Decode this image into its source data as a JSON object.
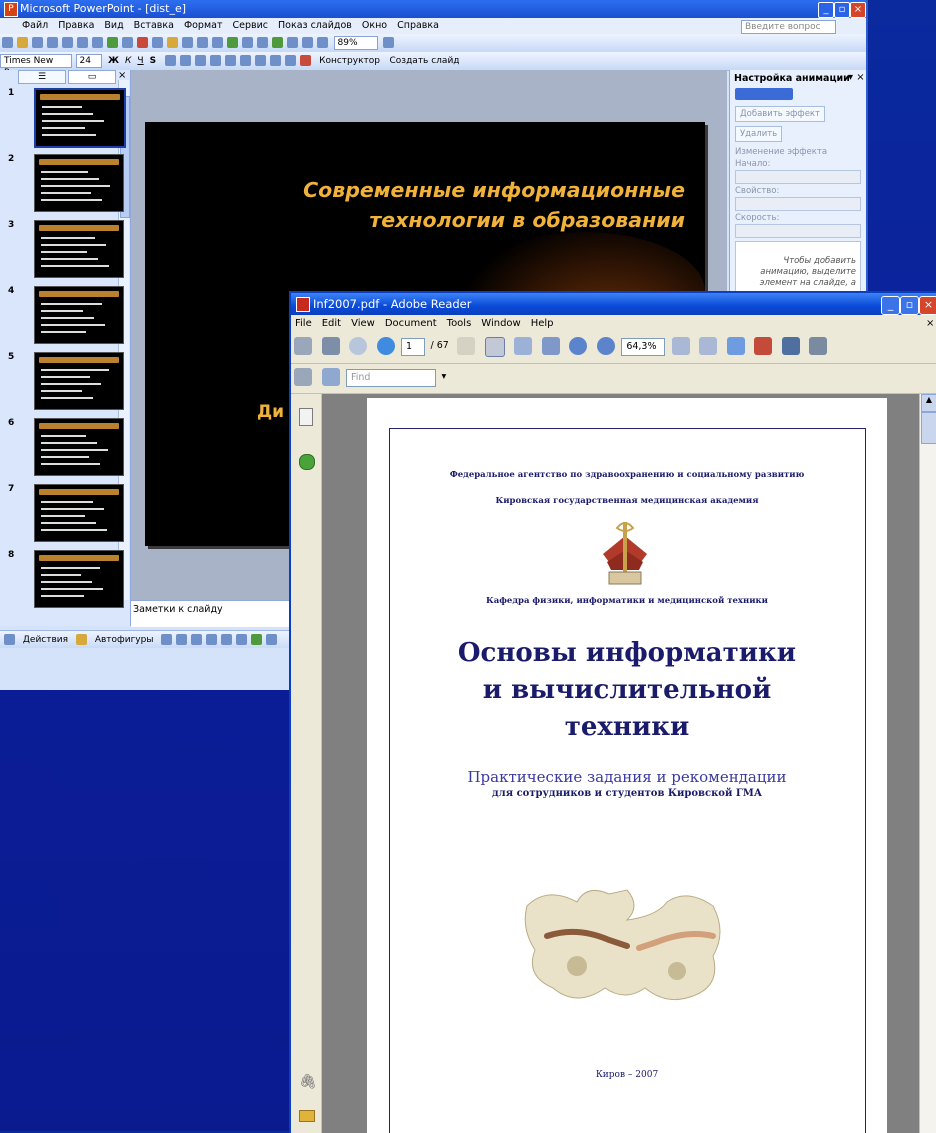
{
  "ppt": {
    "title": "Microsoft PowerPoint - [dist_e]",
    "menu": [
      "Файл",
      "Правка",
      "Вид",
      "Вставка",
      "Формат",
      "Сервис",
      "Показ слайдов",
      "Окно",
      "Справка"
    ],
    "help_placeholder": "Введите вопрос",
    "zoom": "89%",
    "font_name": "Times New Roman",
    "font_size": "24",
    "format_buttons": [
      "Ж",
      "К",
      "Ч",
      "S"
    ],
    "designer_label": "Конструктор",
    "new_slide_label": "Создать слайд",
    "slide": {
      "title_line1": "Современные информационные",
      "title_line2": "технологии в образовании",
      "subtitle_fragment": "Ди"
    },
    "slide_numbers": [
      "1",
      "2",
      "3",
      "4",
      "5",
      "6",
      "7",
      "8"
    ],
    "notes_placeholder": "Заметки к слайду",
    "draw_actions_label": "Действия",
    "autoshapes_label": "Автофигуры",
    "taskpane": {
      "title": "Настройка анимации",
      "add_effect": "Добавить эффект",
      "remove": "Удалить",
      "change_effect": "Изменение эффекта",
      "start_label": "Начало:",
      "property_label": "Свойство:",
      "speed_label": "Скорость:",
      "info_text": "Чтобы добавить анимацию, выделите элемент на слайде, а затем нажмите кнопку \"Добавить эффект\"."
    }
  },
  "reader": {
    "title": "Inf2007.pdf - Adobe Reader",
    "menu": [
      "File",
      "Edit",
      "View",
      "Document",
      "Tools",
      "Window",
      "Help"
    ],
    "page_current": "1",
    "page_total": "/ 67",
    "zoom": "64,3%",
    "find_placeholder": "Find",
    "page": {
      "agency": "Федеральное агентство по здравоохранению и социальному развитию",
      "academy": "Кировская государственная медицинская академия",
      "department": "Кафедра физики, информатики и медицинской техники",
      "title_line1": "Основы информатики",
      "title_line2": "и вычислительной",
      "title_line3": "техники",
      "subtitle": "Практические задания и рекомендации",
      "subtitle2": "для сотрудников и студентов Кировской ГМА",
      "footer": "Киров – 2007"
    }
  },
  "colors": {
    "desktop": "#0c1f9a",
    "xp_titlebar": "#0a4ad8",
    "slide_title": "#f0b23a",
    "doc_text": "#1b1b6b"
  }
}
